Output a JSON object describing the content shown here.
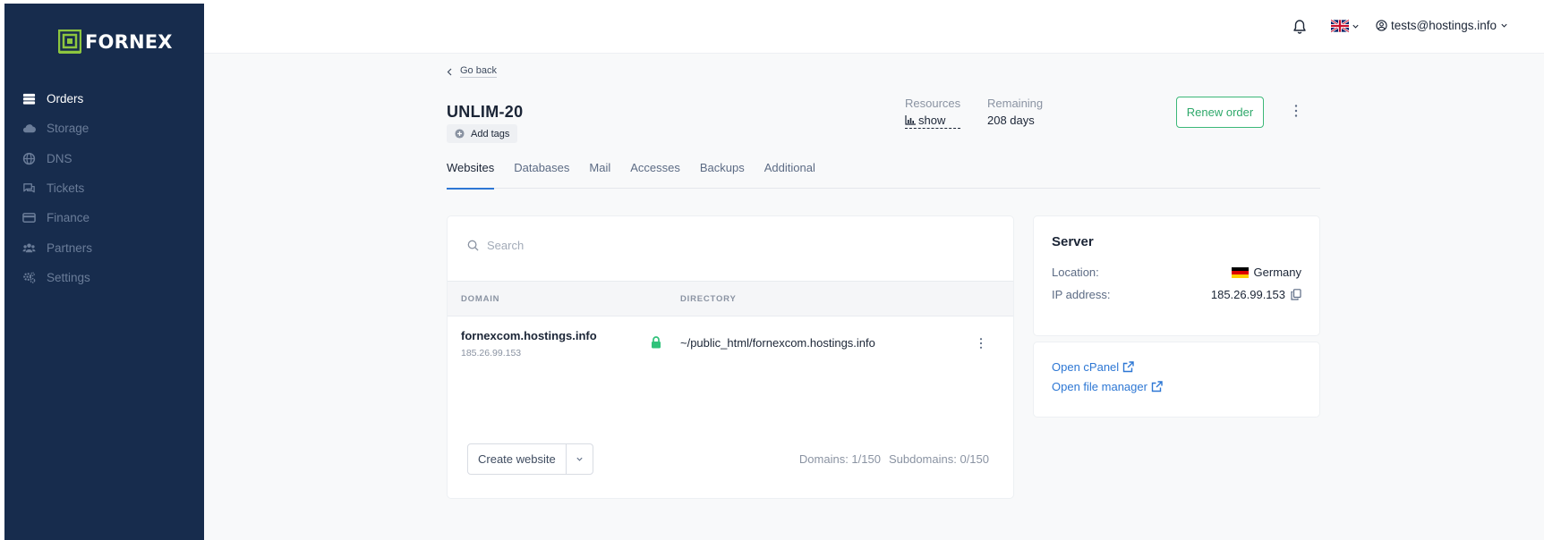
{
  "brand": {
    "name": "FORNEX",
    "accent": "#8dc63f",
    "sidebar_bg": "#172c4d"
  },
  "sidebar": {
    "items": [
      {
        "label": "Orders",
        "icon": "server-icon",
        "active": true
      },
      {
        "label": "Storage",
        "icon": "cloud-icon"
      },
      {
        "label": "DNS",
        "icon": "globe-icon"
      },
      {
        "label": "Tickets",
        "icon": "chat-icon"
      },
      {
        "label": "Finance",
        "icon": "card-icon"
      },
      {
        "label": "Partners",
        "icon": "users-icon"
      },
      {
        "label": "Settings",
        "icon": "gears-icon"
      }
    ]
  },
  "topbar": {
    "notifications_icon": "bell-icon",
    "language_icon": "uk-flag-icon",
    "user_email": "tests@hostings.info"
  },
  "order": {
    "back_label": "Go back",
    "title": "UNLIM-20",
    "add_tags_label": "Add tags",
    "resources_label": "Resources",
    "resources_value": "show",
    "remaining_label": "Remaining",
    "remaining_value": "208 days",
    "renew_label": "Renew order"
  },
  "tabs": [
    {
      "label": "Websites",
      "active": true
    },
    {
      "label": "Databases"
    },
    {
      "label": "Mail"
    },
    {
      "label": "Accesses"
    },
    {
      "label": "Backups"
    },
    {
      "label": "Additional"
    }
  ],
  "websites": {
    "search_placeholder": "Search",
    "columns": [
      "DOMAIN",
      "DIRECTORY"
    ],
    "rows": [
      {
        "domain": "fornexcom.hostings.info",
        "ip": "185.26.99.153",
        "ssl": true,
        "directory": "~/public_html/fornexcom.hostings.info"
      }
    ],
    "create_label": "Create website",
    "domains_count": "Domains: 1/150",
    "subdomains_count": "Subdomains: 0/150"
  },
  "server": {
    "title": "Server",
    "location_label": "Location:",
    "location_value": "Germany",
    "ip_label": "IP address:",
    "ip_value": "185.26.99.153"
  },
  "links": {
    "cpanel": "Open cPanel",
    "file_manager": "Open file manager"
  }
}
